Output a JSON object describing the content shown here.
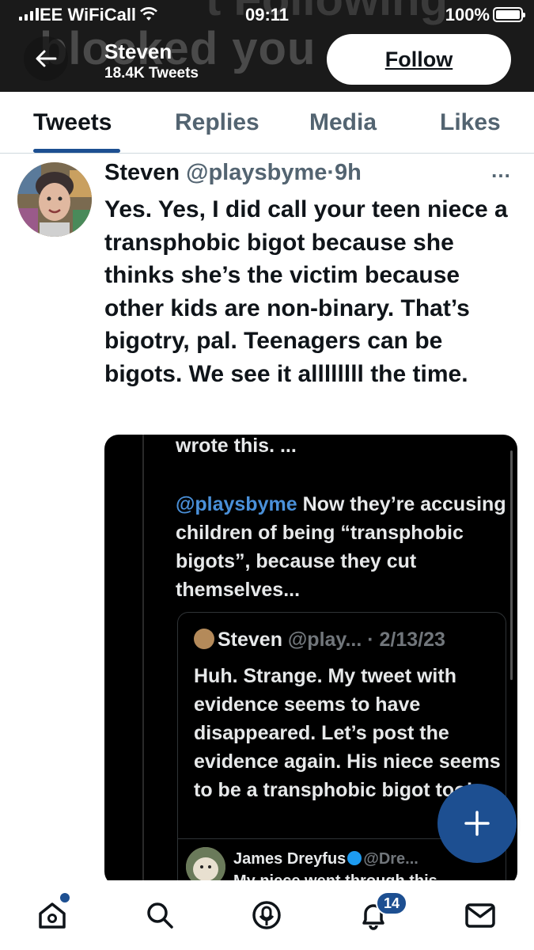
{
  "status_bar": {
    "carrier": "EE WiFiCall",
    "time": "09:11",
    "battery_percent": "100%",
    "battery_level": 1.0,
    "signal_bars": 4
  },
  "banner": {
    "ghost_text_top": "t Following",
    "ghost_text_main": "blocked you"
  },
  "header": {
    "profile_name": "Steven",
    "tweet_count": "18.4K Tweets",
    "follow_label": "Follow"
  },
  "tabs": [
    {
      "label": "Tweets",
      "active": true
    },
    {
      "label": "Replies",
      "active": false
    },
    {
      "label": "Media",
      "active": false
    },
    {
      "label": "Likes",
      "active": false
    }
  ],
  "tweet": {
    "author_name": "Steven",
    "author_handle": "@playsbyme",
    "separator": "·",
    "time": "9h",
    "more_icon": "…",
    "text": "Yes. Yes, I did call your teen niece a transphobic bigot because she thinks she’s the victim because other kids are non-binary. That’s bigotry, pal. Teenagers can be bigots. We see it allllllll the time."
  },
  "embedded_image": {
    "top_text": "wrote this. ...",
    "quote_mention": "@playsbyme",
    "quote_text": " Now they’re accusing children of being “transphobic bigots”, because they cut themselves...",
    "card": {
      "name": "Steven",
      "handle_date": " @play... · 2/13/23",
      "text": "Huh. Strange. My tweet with evidence seems to have disappeared. Let’s post the evidence again. His niece seems to be a transphobic bigot too!"
    },
    "reply": {
      "name": "James Dreyfus",
      "handle": "@Dre...",
      "text": "My niece went through this"
    }
  },
  "fab": {
    "icon": "plus-icon"
  },
  "bottom_nav": {
    "items": [
      "home-icon",
      "search-icon",
      "spaces-icon",
      "notifications-icon",
      "messages-icon"
    ],
    "notification_count": "14",
    "accent": "#1d4f91"
  }
}
